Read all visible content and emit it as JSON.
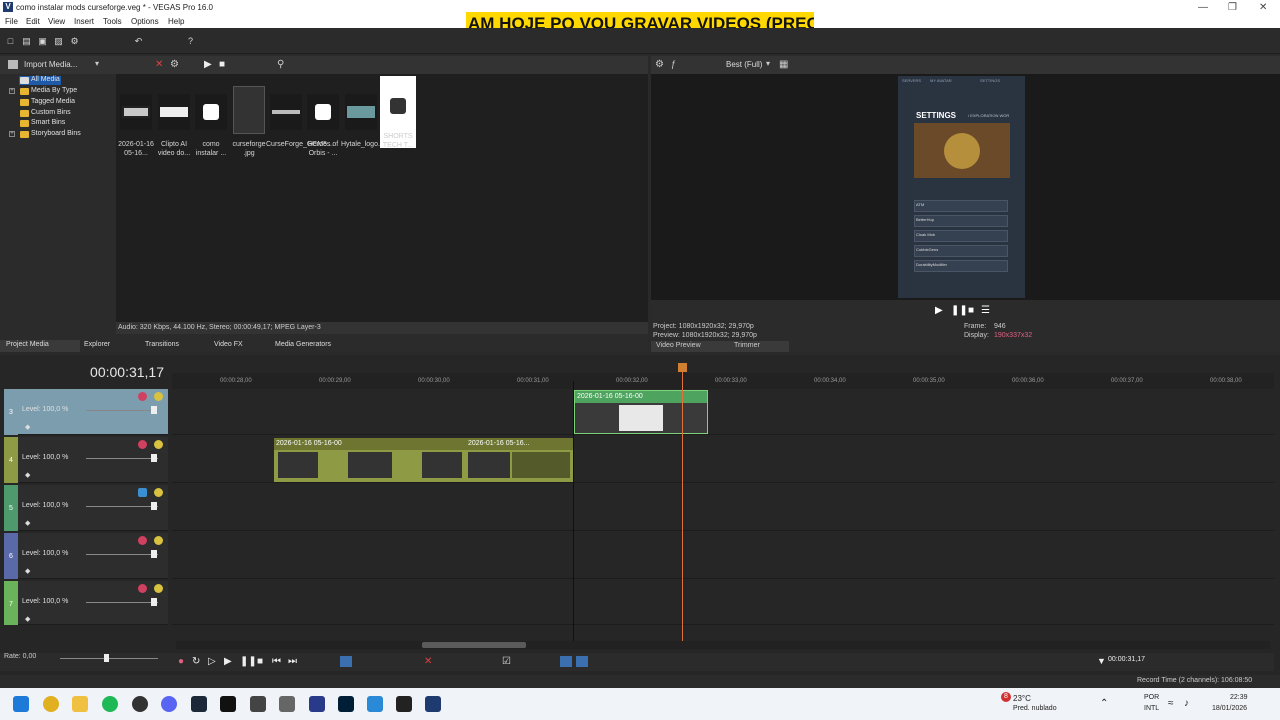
{
  "window": {
    "title": "como instalar mods curseforge.veg * - VEGAS Pro 16.0",
    "icon_letter": "V"
  },
  "banner": {
    "text": "AM HOJE PQ VOU GRAVAR VIDEOS (PRECIS"
  },
  "menu": [
    "File",
    "Edit",
    "View",
    "Insert",
    "Tools",
    "Options",
    "Help"
  ],
  "media_toolbar": {
    "import_label": "Import Media..."
  },
  "tree": [
    "All Media",
    "Media By Type",
    "Tagged Media",
    "Custom Bins",
    "Smart Bins",
    "Storyboard Bins"
  ],
  "thumbs": [
    {
      "label": "2026-01-16 05-16..."
    },
    {
      "label": "Clipto AI video do..."
    },
    {
      "label": "como instalar ..."
    },
    {
      "label": "curseforge .jpg"
    },
    {
      "label": "CurseForge_GCM5..."
    },
    {
      "label": "Heroes of Orbis - ..."
    },
    {
      "label": "Hytale_logo.png"
    },
    {
      "label": "SHORTS TECH T..."
    }
  ],
  "media_status": "Audio: 320 Kbps, 44.100 Hz, Stereo; 00:00:49,17; MPEG Layer-3",
  "tabs": [
    "Project Media",
    "Explorer",
    "Transitions",
    "Video FX",
    "Media Generators"
  ],
  "preview": {
    "quality": "Best (Full)",
    "project": "Project:  1080x1920x32; 29,970p",
    "preview": "Preview:  1080x1920x32; 29,970p",
    "frame_label": "Frame:",
    "frame_value": "946",
    "display_label": "Display:",
    "display_value": "190x337x32",
    "tab_video_preview": "Video Preview",
    "tab_trimmer": "Trimmer",
    "screen_title": "SETTINGS",
    "screen_subtitle": "/ EXPLORATION WOR",
    "screen_nav": [
      "SERVERS",
      "MY AVATAR",
      "SETTINGS"
    ],
    "screen_rows": [
      "ATM",
      "BetterHop",
      "Cloak Mob",
      "CobbleGens",
      "DurabilityModifier"
    ]
  },
  "timeline": {
    "timecode": "00:00:31,17",
    "ticks": [
      "00:00:28,00",
      "00:00:29,00",
      "00:00:30,00",
      "00:00:31,00",
      "00:00:32,00",
      "00:00:33,00",
      "00:00:34,00",
      "00:00:35,00",
      "00:00:36,00",
      "00:00:37,00",
      "00:00:38,00"
    ],
    "tracks": [
      {
        "num": "3",
        "level": "Level: 100,0 %",
        "color": "#7b9dae"
      },
      {
        "num": "4",
        "level": "Level: 100,0 %",
        "color": "#8f9a44"
      },
      {
        "num": "5",
        "level": "Level: 100,0 %",
        "color": "#4f9a6c"
      },
      {
        "num": "6",
        "level": "Level: 100,0 %",
        "color": "#5a6aa8"
      },
      {
        "num": "7",
        "level": "Level: 100,0 %",
        "color": "#6bb35a"
      }
    ],
    "clips": [
      {
        "label": "2026-01-16 05-16-00"
      },
      {
        "label": "2026-01-16 05-16-00"
      },
      {
        "label": "2026-01-16 05-16..."
      }
    ],
    "rate": "Rate: 0,00",
    "cursor_time": "00:00:31,17"
  },
  "status": {
    "record_time": "Record Time (2 channels): 106:08:50"
  },
  "taskbar": {
    "weather_temp": "23°C",
    "weather_desc": "Pred. nublado",
    "lang1": "POR",
    "lang2": "INTL",
    "time": "22:39",
    "date": "18/01/2026",
    "badge": "8"
  },
  "colors": {
    "accent": "#ffd800",
    "selected_track": "#7b9dae",
    "display_value": "#e06080"
  }
}
